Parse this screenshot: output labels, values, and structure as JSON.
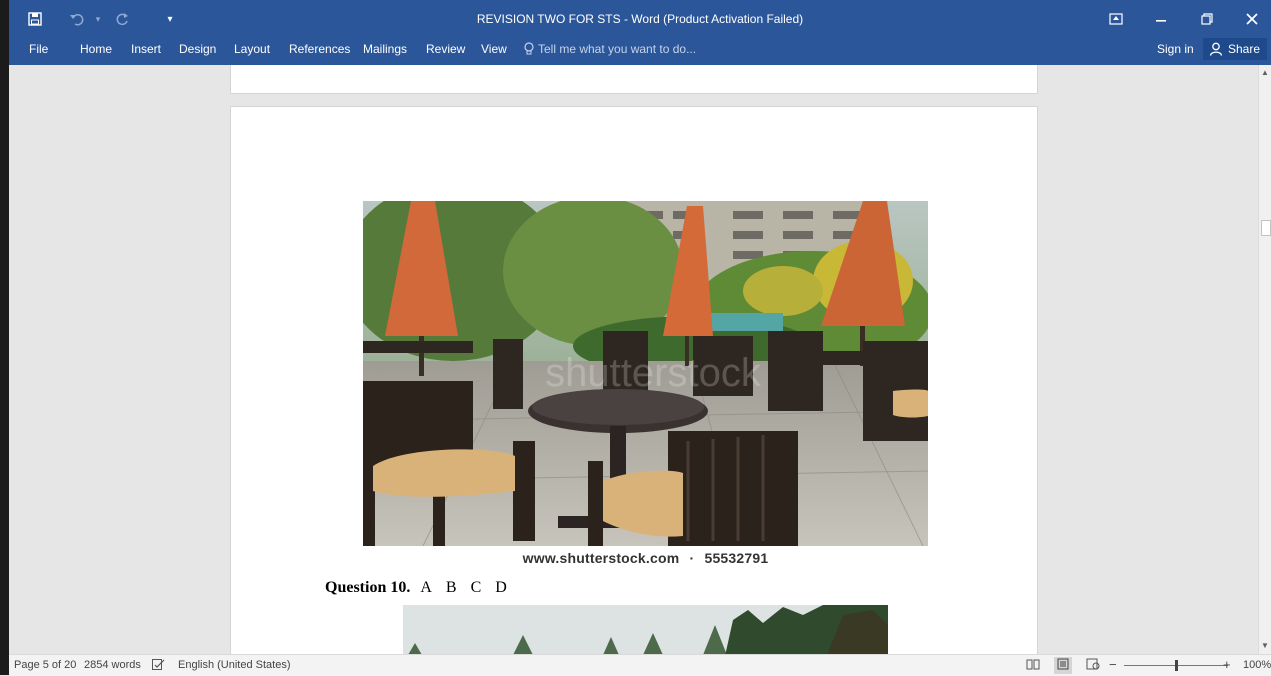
{
  "window": {
    "title": "REVISION TWO FOR STS - Word (Product Activation Failed)"
  },
  "quick_access": {
    "save_icon": "save-icon",
    "undo_icon": "undo-icon",
    "redo_icon": "redo-icon",
    "customize_icon": "customize-qat-icon"
  },
  "ribbon": {
    "tabs": [
      "File",
      "Home",
      "Insert",
      "Design",
      "Layout",
      "References",
      "Mailings",
      "Review",
      "View"
    ],
    "tell_me_placeholder": "Tell me what you want to do...",
    "sign_in": "Sign in",
    "share": "Share"
  },
  "document": {
    "image1_caption_site": "www.shutterstock.com",
    "image1_caption_sep": "·",
    "image1_caption_id": "55532791",
    "image1_watermark": "shutterstock",
    "question_label": "Question 10.",
    "question_options": [
      "A",
      "B",
      "C",
      "D"
    ]
  },
  "status": {
    "page": "Page 5 of 20",
    "words": "2854 words",
    "language": "English (United States)",
    "zoom_minus": "−",
    "zoom_plus": "+",
    "zoom": "100%",
    "zoom_level_fraction": 0.5
  },
  "colors": {
    "accent": "#2b579a"
  }
}
